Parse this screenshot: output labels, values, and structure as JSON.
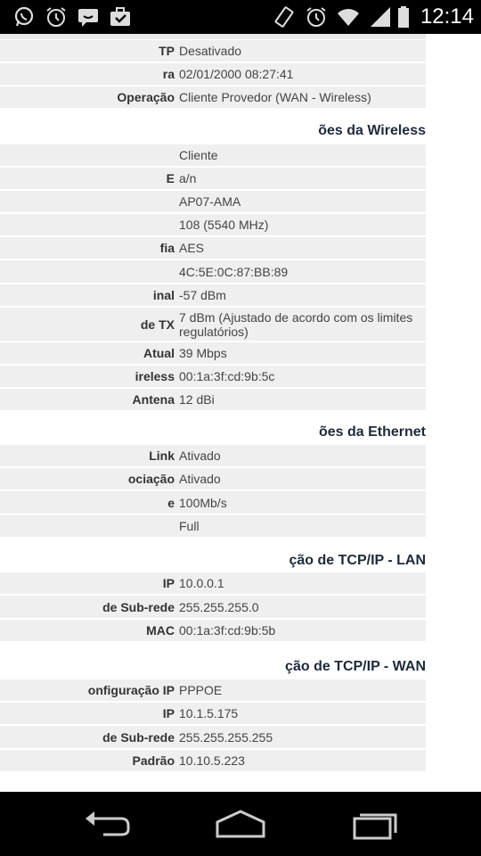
{
  "status": {
    "time": "12:14",
    "icons": [
      "whatsapp-icon",
      "alarm-icon",
      "message-icon",
      "briefcase-icon",
      "vibrate-icon",
      "alarm-icon",
      "wifi-icon",
      "signal-icon",
      "battery-icon"
    ]
  },
  "sections": {
    "wireless": "ões da Wireless",
    "ethernet": "ões da Ethernet",
    "lan": "ção de TCP/IP - LAN",
    "wan": "ção de TCP/IP - WAN"
  },
  "rows": {
    "r0": {
      "label": "TP",
      "value": "Desativado"
    },
    "r1": {
      "label": "ra",
      "value": "02/01/2000 08:27:41"
    },
    "r2": {
      "label": "Operação",
      "value": "Cliente Provedor (WAN - Wireless)"
    },
    "w0": {
      "label": "",
      "value": "Cliente"
    },
    "w1": {
      "label": "E",
      "value": "a/n"
    },
    "w2": {
      "label": "",
      "value": "AP07-AMA"
    },
    "w3": {
      "label": "",
      "value": "108 (5540 MHz)"
    },
    "w4": {
      "label": "fia",
      "value": "AES"
    },
    "w5": {
      "label": "",
      "value": "4C:5E:0C:87:BB:89"
    },
    "w6": {
      "label": "inal",
      "value": "-57 dBm"
    },
    "w7": {
      "label": "de TX",
      "value": "7 dBm   (Ajustado de acordo com os limites regulatórios)"
    },
    "w8": {
      "label": "Atual",
      "value": "39 Mbps"
    },
    "w9": {
      "label": "ireless",
      "value": "00:1a:3f:cd:9b:5c"
    },
    "w10": {
      "label": "Antena",
      "value": "12 dBi"
    },
    "e0": {
      "label": "Link",
      "value": "Ativado"
    },
    "e1": {
      "label": "ociação",
      "value": "Ativado"
    },
    "e2": {
      "label": "e",
      "value": "100Mb/s"
    },
    "e3": {
      "label": "",
      "value": "Full"
    },
    "l0": {
      "label": "IP",
      "value": "10.0.0.1"
    },
    "l1": {
      "label": "de Sub-rede",
      "value": "255.255.255.0"
    },
    "l2": {
      "label": "MAC",
      "value": "00:1a:3f:cd:9b:5b"
    },
    "n0": {
      "label": "onfiguração IP",
      "value": "PPPOE"
    },
    "n1": {
      "label": "IP",
      "value": "10.1.5.175"
    },
    "n2": {
      "label": "de Sub-rede",
      "value": "255.255.255.255"
    },
    "n3": {
      "label": "Padrão",
      "value": "10.10.5.223"
    }
  },
  "navbar": {
    "icons": [
      "back-icon",
      "home-icon",
      "recent-apps-icon"
    ]
  }
}
